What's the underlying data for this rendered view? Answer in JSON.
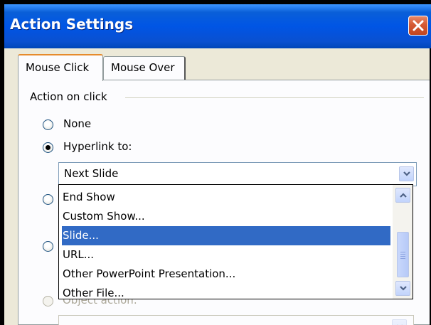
{
  "window": {
    "title": "Action Settings"
  },
  "tabs": [
    {
      "label": "Mouse Click",
      "selected": true
    },
    {
      "label": "Mouse Over",
      "selected": false
    }
  ],
  "group": {
    "label": "Action on click"
  },
  "options": {
    "none": "None",
    "hyperlink": "Hyperlink to:",
    "object_action": "Object action:"
  },
  "hyperlink_combo": {
    "value": "Next Slide"
  },
  "dropdown_items": [
    "End Show",
    "Custom Show...",
    "Slide...",
    "URL...",
    "Other PowerPoint Presentation...",
    "Other File..."
  ],
  "selected_item": "Slide...",
  "icons": {
    "close": "close-icon",
    "dropdown": "chevron-down-icon",
    "scroll_up": "scroll-up-arrow-icon",
    "scroll_down": "scroll-down-arrow-icon"
  },
  "colors": {
    "titlebar": "#0055e5",
    "close_button": "#d55a34",
    "selection": "#316ac5",
    "active_tab_accent": "#e68b2c"
  }
}
